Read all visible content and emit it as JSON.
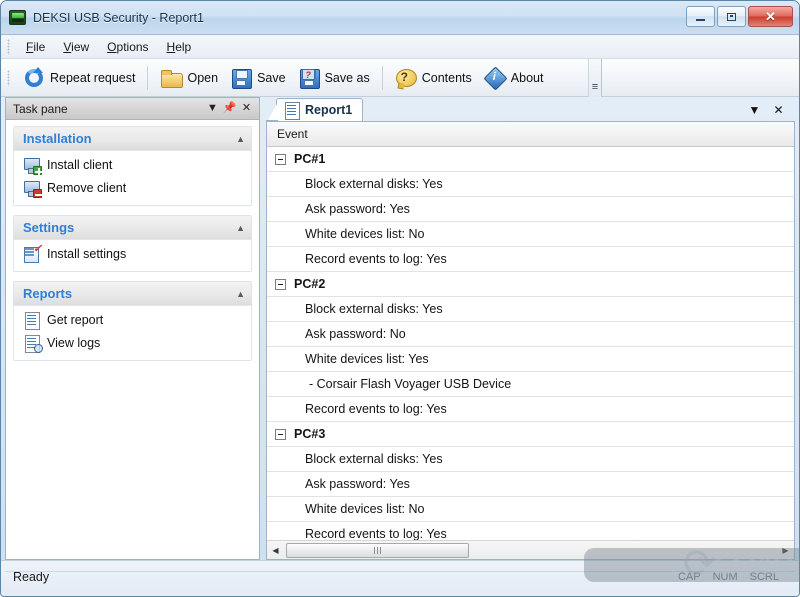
{
  "window": {
    "title": "DEKSI USB Security - Report1",
    "app_icon": "usb-device-icon",
    "buttons": {
      "minimize": "minimize-button",
      "maximize": "maximize-button",
      "close": "✕"
    }
  },
  "menubar": {
    "items": [
      {
        "label": "File",
        "mnemonic": "F"
      },
      {
        "label": "View",
        "mnemonic": "V"
      },
      {
        "label": "Options",
        "mnemonic": "O"
      },
      {
        "label": "Help",
        "mnemonic": "H"
      }
    ]
  },
  "toolbar": {
    "buttons": [
      {
        "label": "Repeat request",
        "icon": "refresh-icon"
      },
      {
        "label": "Open",
        "icon": "folder-open-icon"
      },
      {
        "label": "Save",
        "icon": "floppy-disk-icon"
      },
      {
        "label": "Save as",
        "icon": "floppy-disk-question-icon"
      },
      {
        "label": "Contents",
        "icon": "help-balloon-icon"
      },
      {
        "label": "About",
        "icon": "info-diamond-icon"
      }
    ],
    "overflow": "toolbar-overflow-icon"
  },
  "task_pane": {
    "title": "Task pane",
    "header_buttons": [
      {
        "name": "dropdown",
        "glyph": "▼"
      },
      {
        "name": "pin",
        "glyph": "⏐"
      },
      {
        "name": "close",
        "glyph": "✕"
      }
    ],
    "groups": [
      {
        "title": "Installation",
        "collapse_glyph": "▲",
        "items": [
          {
            "label": "Install client",
            "icon": "computer-add-icon"
          },
          {
            "label": "Remove client",
            "icon": "computer-remove-icon"
          }
        ]
      },
      {
        "title": "Settings",
        "collapse_glyph": "▲",
        "items": [
          {
            "label": "Install settings",
            "icon": "checklist-icon"
          }
        ]
      },
      {
        "title": "Reports",
        "collapse_glyph": "▲",
        "items": [
          {
            "label": "Get report",
            "icon": "document-icon"
          },
          {
            "label": "View logs",
            "icon": "document-search-icon"
          }
        ]
      }
    ]
  },
  "report": {
    "tab": {
      "label": "Report1",
      "icon": "report-document-icon"
    },
    "tab_controls": [
      {
        "name": "dropdown",
        "glyph": "▼"
      },
      {
        "name": "close",
        "glyph": "✕"
      }
    ],
    "column_header": "Event",
    "rows": [
      {
        "type": "group",
        "label": "PC#1"
      },
      {
        "type": "child",
        "label": "Block external disks: Yes"
      },
      {
        "type": "child",
        "label": "Ask password: Yes"
      },
      {
        "type": "child",
        "label": "White devices list: No"
      },
      {
        "type": "child",
        "label": "Record events to log: Yes"
      },
      {
        "type": "group",
        "label": "PC#2"
      },
      {
        "type": "child",
        "label": "Block external disks: Yes"
      },
      {
        "type": "child",
        "label": "Ask password: No"
      },
      {
        "type": "child",
        "label": "White devices list: Yes"
      },
      {
        "type": "sub",
        "label": "- Corsair Flash Voyager USB Device"
      },
      {
        "type": "child",
        "label": "Record events to log: Yes"
      },
      {
        "type": "group",
        "label": "PC#3"
      },
      {
        "type": "child",
        "label": "Block external disks: Yes"
      },
      {
        "type": "child",
        "label": "Ask password: Yes"
      },
      {
        "type": "child",
        "label": "White devices list: No"
      },
      {
        "type": "child",
        "label": "Record events to log: Yes"
      }
    ],
    "hscroll": {
      "left_arrow": "◀",
      "right_arrow": "▶"
    }
  },
  "statusbar": {
    "text": "Ready",
    "indicators": [
      "CAP",
      "NUM",
      "SCRL"
    ]
  },
  "watermark": {
    "text": "LO4D",
    "arrows": "↻"
  },
  "colors": {
    "accent_blue": "#2f7fd4",
    "title_text": "#16334d",
    "close_red": "#cc3c2c"
  }
}
